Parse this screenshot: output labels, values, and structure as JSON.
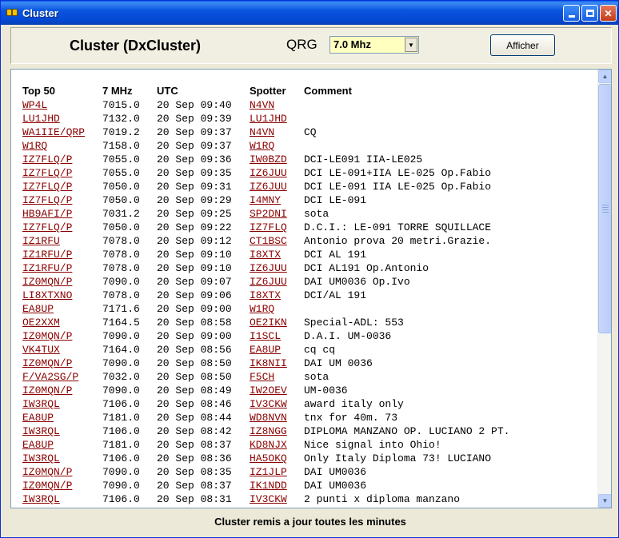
{
  "window": {
    "title": "Cluster"
  },
  "header": {
    "app_title": "Cluster (DxCluster)",
    "qrg_label": "QRG",
    "qrg_value": "7.0 Mhz",
    "afficher_label": "Afficher"
  },
  "columns": {
    "call": "Top 50",
    "freq": "7 MHz",
    "time": "UTC",
    "spotter": "Spotter",
    "comment": "Comment"
  },
  "rows": [
    {
      "call": "WP4L",
      "freq": "7015.0",
      "time": "20 Sep 09:40",
      "spotter": "N4VN",
      "comment": ""
    },
    {
      "call": "LU1JHD",
      "freq": "7132.0",
      "time": "20 Sep 09:39",
      "spotter": "LU1JHD",
      "comment": ""
    },
    {
      "call": "WA1IIE/QRP",
      "freq": "7019.2",
      "time": "20 Sep 09:37",
      "spotter": "N4VN",
      "comment": "CQ"
    },
    {
      "call": "W1RQ",
      "freq": "7158.0",
      "time": "20 Sep 09:37",
      "spotter": "W1RQ",
      "comment": ""
    },
    {
      "call": "IZ7FLQ/P",
      "freq": "7055.0",
      "time": "20 Sep 09:36",
      "spotter": "IW0BZD",
      "comment": "DCI-LE091 IIA-LE025"
    },
    {
      "call": "IZ7FLQ/P",
      "freq": "7055.0",
      "time": "20 Sep 09:35",
      "spotter": "IZ6JUU",
      "comment": "DCI LE-091+IIA LE-025 Op.Fabio"
    },
    {
      "call": "IZ7FLQ/P",
      "freq": "7050.0",
      "time": "20 Sep 09:31",
      "spotter": "IZ6JUU",
      "comment": "DCI LE-091 IIA LE-025 Op.Fabio"
    },
    {
      "call": "IZ7FLQ/P",
      "freq": "7050.0",
      "time": "20 Sep 09:29",
      "spotter": "I4MNY",
      "comment": "DCI LE-091"
    },
    {
      "call": "HB9AFI/P",
      "freq": "7031.2",
      "time": "20 Sep 09:25",
      "spotter": "SP2DNI",
      "comment": "sota"
    },
    {
      "call": "IZ7FLQ/P",
      "freq": "7050.0",
      "time": "20 Sep 09:22",
      "spotter": "IZ7FLQ",
      "comment": "D.C.I.: LE-091 TORRE SQUILLACE"
    },
    {
      "call": "IZ1RFU",
      "freq": "7078.0",
      "time": "20 Sep 09:12",
      "spotter": "CT1BSC",
      "comment": "Antonio prova 20 metri.Grazie."
    },
    {
      "call": "IZ1RFU/P",
      "freq": "7078.0",
      "time": "20 Sep 09:10",
      "spotter": "I8XTX",
      "comment": "DCI AL 191"
    },
    {
      "call": "IZ1RFU/P",
      "freq": "7078.0",
      "time": "20 Sep 09:10",
      "spotter": "IZ6JUU",
      "comment": "DCI AL191 Op.Antonio"
    },
    {
      "call": "IZ0MQN/P",
      "freq": "7090.0",
      "time": "20 Sep 09:07",
      "spotter": "IZ6JUU",
      "comment": "DAI UM0036 Op.Ivo"
    },
    {
      "call": "LI8XTXNO",
      "freq": "7078.0",
      "time": "20 Sep 09:06",
      "spotter": "I8XTX",
      "comment": "DCI/AL 191"
    },
    {
      "call": "EA8UP",
      "freq": "7171.6",
      "time": "20 Sep 09:00",
      "spotter": "W1RQ",
      "comment": ""
    },
    {
      "call": "OE2XXM",
      "freq": "7164.5",
      "time": "20 Sep 08:58",
      "spotter": "OE2IKN",
      "comment": "Special-ADL: 553"
    },
    {
      "call": "IZ0MQN/P",
      "freq": "7090.0",
      "time": "20 Sep 09:00",
      "spotter": "I1SCL",
      "comment": "D.A.I. UM-0036"
    },
    {
      "call": "VK4TUX",
      "freq": "7164.0",
      "time": "20 Sep 08:56",
      "spotter": "EA8UP",
      "comment": "cq cq"
    },
    {
      "call": "IZ0MQN/P",
      "freq": "7090.0",
      "time": "20 Sep 08:50",
      "spotter": "IK8NII",
      "comment": "DAI UM 0036"
    },
    {
      "call": "F/VA2SG/P",
      "freq": "7032.0",
      "time": "20 Sep 08:50",
      "spotter": "F5CH",
      "comment": "sota"
    },
    {
      "call": "IZ0MQN/P",
      "freq": "7090.0",
      "time": "20 Sep 08:49",
      "spotter": "IW2OEV",
      "comment": "UM-0036"
    },
    {
      "call": "IW3RQL",
      "freq": "7106.0",
      "time": "20 Sep 08:46",
      "spotter": "IV3CKW",
      "comment": "award italy only"
    },
    {
      "call": "EA8UP",
      "freq": "7181.0",
      "time": "20 Sep 08:44",
      "spotter": "WD8NVN",
      "comment": "tnx for 40m. 73"
    },
    {
      "call": "IW3RQL",
      "freq": "7106.0",
      "time": "20 Sep 08:42",
      "spotter": "IZ8NGG",
      "comment": "DIPLOMA MANZANO OP. LUCIANO 2 PT."
    },
    {
      "call": "EA8UP",
      "freq": "7181.0",
      "time": "20 Sep 08:37",
      "spotter": "KD8NJX",
      "comment": "Nice signal into Ohio!"
    },
    {
      "call": "IW3RQL",
      "freq": "7106.0",
      "time": "20 Sep 08:36",
      "spotter": "HA5OKQ",
      "comment": "Only Italy Diploma 73! LUCIANO"
    },
    {
      "call": "IZ0MQN/P",
      "freq": "7090.0",
      "time": "20 Sep 08:35",
      "spotter": "IZ1JLP",
      "comment": "DAI UM0036"
    },
    {
      "call": "IZ0MQN/P",
      "freq": "7090.0",
      "time": "20 Sep 08:37",
      "spotter": "IK1NDD",
      "comment": "DAI UM0036"
    },
    {
      "call": "IW3RQL",
      "freq": "7106.0",
      "time": "20 Sep 08:31",
      "spotter": "IV3CKW",
      "comment": "2 punti x diploma manzano"
    }
  ],
  "status": {
    "text": "Cluster remis a jour toutes les minutes"
  }
}
